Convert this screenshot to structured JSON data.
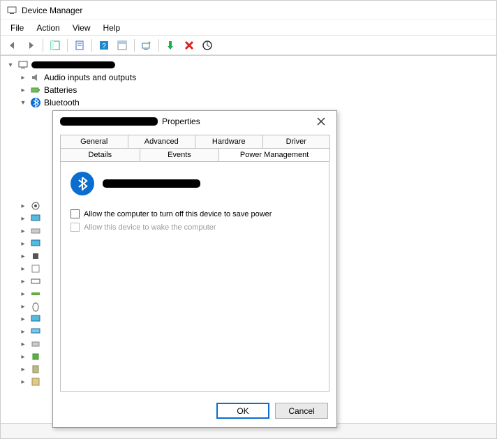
{
  "window": {
    "title": "Device Manager"
  },
  "menubar": {
    "file": "File",
    "action": "Action",
    "view": "View",
    "help": "Help"
  },
  "tree": {
    "audio": "Audio inputs and outputs",
    "batteries": "Batteries",
    "bluetooth": "Bluetooth"
  },
  "dialog": {
    "title_suffix": "Properties",
    "tabs": {
      "general": "General",
      "advanced": "Advanced",
      "hardware": "Hardware",
      "driver": "Driver",
      "details": "Details",
      "events": "Events",
      "power": "Power Management"
    },
    "opt_turnoff": "Allow the computer to turn off this device to save power",
    "opt_wake": "Allow this device to wake the computer",
    "ok": "OK",
    "cancel": "Cancel"
  }
}
